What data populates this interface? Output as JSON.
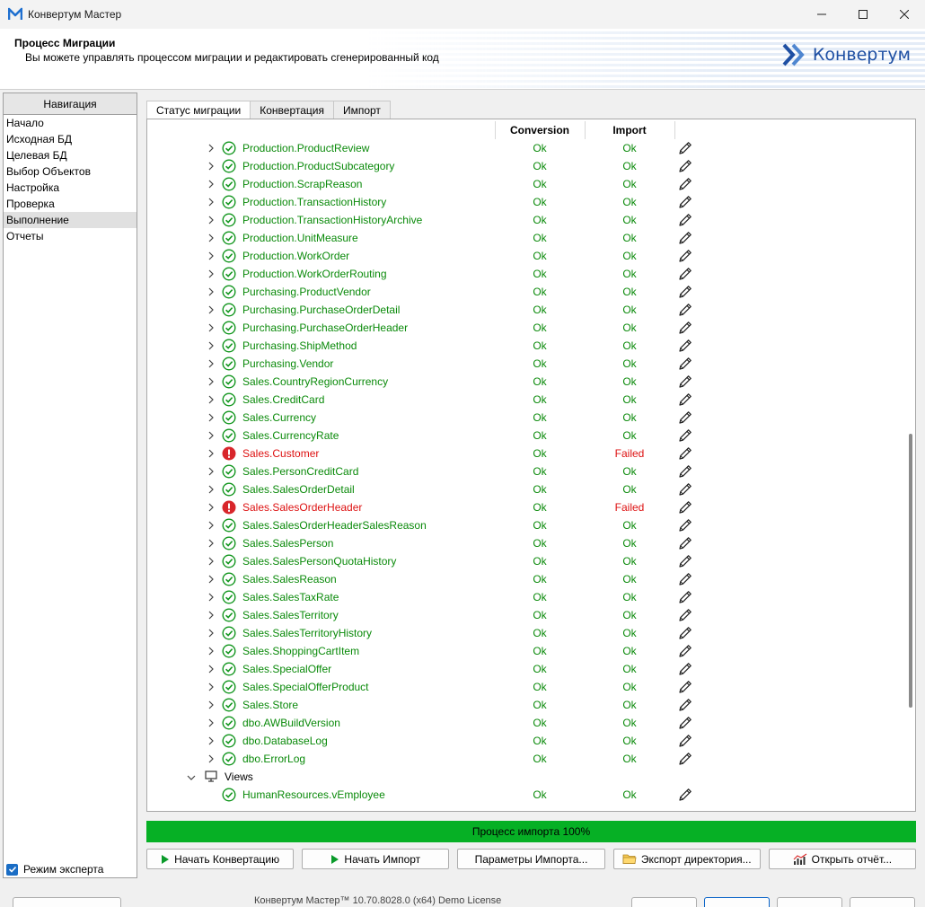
{
  "window": {
    "title": "Конвертум Мастер"
  },
  "header": {
    "title": "Процесс Миграции",
    "subtitle": "Вы можете управлять процессом миграции и редактировать сгенерированный код",
    "logo_text": "Конвертум"
  },
  "nav": {
    "header": "Навигация",
    "items": [
      "Начало",
      "Исходная БД",
      "Целевая БД",
      "Выбор Объектов",
      "Настройка",
      "Проверка",
      "Выполнение",
      "Отчеты"
    ],
    "active_index": 6,
    "expert_mode_label": "Режим эксперта",
    "expert_mode_checked": true
  },
  "tabs": [
    "Статус миграции",
    "Конвертация",
    "Импорт"
  ],
  "table": {
    "columns": {
      "conversion": "Conversion",
      "import": "Import"
    },
    "rows": [
      {
        "name": "Production.ProductReview",
        "conversion": "Ok",
        "import": "Ok",
        "status": "ok"
      },
      {
        "name": "Production.ProductSubcategory",
        "conversion": "Ok",
        "import": "Ok",
        "status": "ok"
      },
      {
        "name": "Production.ScrapReason",
        "conversion": "Ok",
        "import": "Ok",
        "status": "ok"
      },
      {
        "name": "Production.TransactionHistory",
        "conversion": "Ok",
        "import": "Ok",
        "status": "ok"
      },
      {
        "name": "Production.TransactionHistoryArchive",
        "conversion": "Ok",
        "import": "Ok",
        "status": "ok"
      },
      {
        "name": "Production.UnitMeasure",
        "conversion": "Ok",
        "import": "Ok",
        "status": "ok"
      },
      {
        "name": "Production.WorkOrder",
        "conversion": "Ok",
        "import": "Ok",
        "status": "ok"
      },
      {
        "name": "Production.WorkOrderRouting",
        "conversion": "Ok",
        "import": "Ok",
        "status": "ok"
      },
      {
        "name": "Purchasing.ProductVendor",
        "conversion": "Ok",
        "import": "Ok",
        "status": "ok"
      },
      {
        "name": "Purchasing.PurchaseOrderDetail",
        "conversion": "Ok",
        "import": "Ok",
        "status": "ok"
      },
      {
        "name": "Purchasing.PurchaseOrderHeader",
        "conversion": "Ok",
        "import": "Ok",
        "status": "ok"
      },
      {
        "name": "Purchasing.ShipMethod",
        "conversion": "Ok",
        "import": "Ok",
        "status": "ok"
      },
      {
        "name": "Purchasing.Vendor",
        "conversion": "Ok",
        "import": "Ok",
        "status": "ok"
      },
      {
        "name": "Sales.CountryRegionCurrency",
        "conversion": "Ok",
        "import": "Ok",
        "status": "ok"
      },
      {
        "name": "Sales.CreditCard",
        "conversion": "Ok",
        "import": "Ok",
        "status": "ok"
      },
      {
        "name": "Sales.Currency",
        "conversion": "Ok",
        "import": "Ok",
        "status": "ok"
      },
      {
        "name": "Sales.CurrencyRate",
        "conversion": "Ok",
        "import": "Ok",
        "status": "ok"
      },
      {
        "name": "Sales.Customer",
        "conversion": "Ok",
        "import": "Failed",
        "status": "fail"
      },
      {
        "name": "Sales.PersonCreditCard",
        "conversion": "Ok",
        "import": "Ok",
        "status": "ok"
      },
      {
        "name": "Sales.SalesOrderDetail",
        "conversion": "Ok",
        "import": "Ok",
        "status": "ok"
      },
      {
        "name": "Sales.SalesOrderHeader",
        "conversion": "Ok",
        "import": "Failed",
        "status": "fail"
      },
      {
        "name": "Sales.SalesOrderHeaderSalesReason",
        "conversion": "Ok",
        "import": "Ok",
        "status": "ok"
      },
      {
        "name": "Sales.SalesPerson",
        "conversion": "Ok",
        "import": "Ok",
        "status": "ok"
      },
      {
        "name": "Sales.SalesPersonQuotaHistory",
        "conversion": "Ok",
        "import": "Ok",
        "status": "ok"
      },
      {
        "name": "Sales.SalesReason",
        "conversion": "Ok",
        "import": "Ok",
        "status": "ok"
      },
      {
        "name": "Sales.SalesTaxRate",
        "conversion": "Ok",
        "import": "Ok",
        "status": "ok"
      },
      {
        "name": "Sales.SalesTerritory",
        "conversion": "Ok",
        "import": "Ok",
        "status": "ok"
      },
      {
        "name": "Sales.SalesTerritoryHistory",
        "conversion": "Ok",
        "import": "Ok",
        "status": "ok"
      },
      {
        "name": "Sales.ShoppingCartItem",
        "conversion": "Ok",
        "import": "Ok",
        "status": "ok"
      },
      {
        "name": "Sales.SpecialOffer",
        "conversion": "Ok",
        "import": "Ok",
        "status": "ok"
      },
      {
        "name": "Sales.SpecialOfferProduct",
        "conversion": "Ok",
        "import": "Ok",
        "status": "ok"
      },
      {
        "name": "Sales.Store",
        "conversion": "Ok",
        "import": "Ok",
        "status": "ok"
      },
      {
        "name": "dbo.AWBuildVersion",
        "conversion": "Ok",
        "import": "Ok",
        "status": "ok"
      },
      {
        "name": "dbo.DatabaseLog",
        "conversion": "Ok",
        "import": "Ok",
        "status": "ok"
      },
      {
        "name": "dbo.ErrorLog",
        "conversion": "Ok",
        "import": "Ok",
        "status": "ok"
      }
    ],
    "views_group": "Views",
    "view_rows": [
      {
        "name": "HumanResources.vEmployee",
        "conversion": "Ok",
        "import": "Ok",
        "status": "ok"
      }
    ]
  },
  "progress": {
    "label": "Процесс импорта 100%",
    "value": 100,
    "color": "#06b025"
  },
  "actions": [
    {
      "label": "Начать Конвертацию",
      "icon": "play-icon"
    },
    {
      "label": "Начать Импорт",
      "icon": "play-icon"
    },
    {
      "label": "Параметры Импорта...",
      "icon": ""
    },
    {
      "label": "Экспорт директория...",
      "icon": "folder-icon"
    },
    {
      "label": "Открыть отчёт...",
      "icon": "chart-icon"
    }
  ],
  "footer": {
    "version": "Конвертум Мастер™ 10.70.8028.0 (x64) Demo License"
  },
  "colors": {
    "ok": "#0a8a0a",
    "fail": "#dd1111",
    "brand": "#1e4fa3"
  }
}
